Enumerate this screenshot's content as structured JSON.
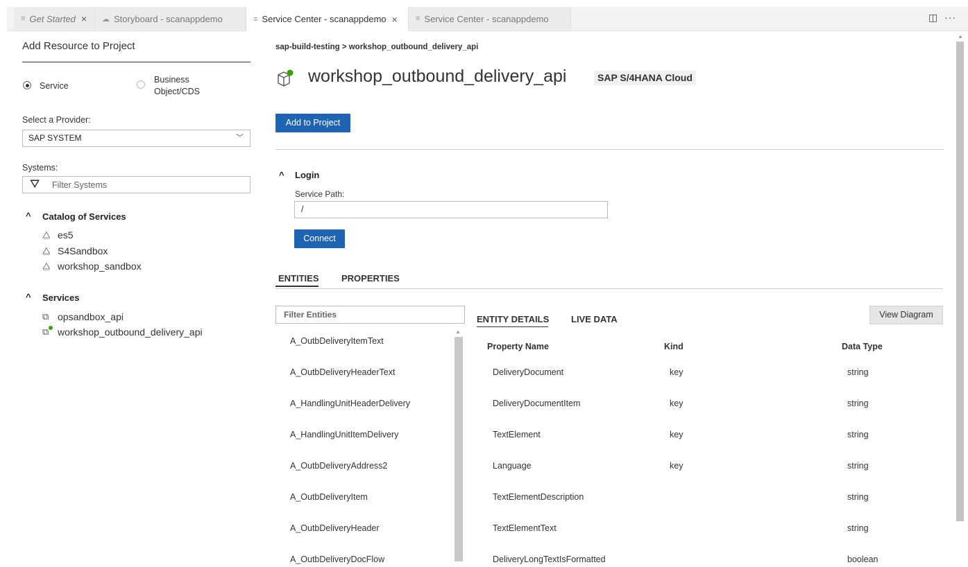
{
  "tabs": [
    {
      "label": "Get Started",
      "italic": true,
      "close": "×"
    },
    {
      "label": "Storyboard - scanappdemo"
    },
    {
      "label": "Service Center - scanappdemo",
      "active": true,
      "close": "×"
    },
    {
      "label": "Service Center - scanappdemo"
    }
  ],
  "window_actions": {
    "split": "◫",
    "more": "···"
  },
  "left": {
    "title": "Add Resource to Project",
    "radio_service": "Service",
    "radio_business_line1": "Business",
    "radio_business_line2": "Object/CDS",
    "provider_label": "Select a Provider:",
    "provider_value": "SAP SYSTEM",
    "systems_label": "Systems:",
    "filter_placeholder": "Filter Systems",
    "catalog_header": "Catalog of Services",
    "catalog_items": [
      "es5",
      "S4Sandbox",
      "workshop_sandbox"
    ],
    "services_header": "Services",
    "service_items": [
      "opsandbox_api",
      "workshop_outbound_delivery_api"
    ]
  },
  "main": {
    "breadcrumb": "sap-build-testing > workshop_outbound_delivery_api",
    "title": "workshop_outbound_delivery_api",
    "badge": "SAP S/4HANA Cloud",
    "add_button": "Add to Project",
    "login_header": "Login",
    "service_path_label": "Service Path:",
    "service_path_value": "/",
    "connect_button": "Connect",
    "tab_entities": "ENTITIES",
    "tab_properties": "PROPERTIES",
    "filter_entities_placeholder": "Filter Entities",
    "entities": [
      "A_OutbDeliveryItemText",
      "A_OutbDeliveryHeaderText",
      "A_HandlingUnitHeaderDelivery",
      "A_HandlingUnitItemDelivery",
      "A_OutbDeliveryAddress2",
      "A_OutbDeliveryItem",
      "A_OutbDeliveryHeader",
      "A_OutbDeliveryDocFlow"
    ],
    "tab_entity_details": "ENTITY DETAILS",
    "tab_live_data": "LIVE DATA",
    "view_diagram": "View Diagram",
    "columns": [
      "Property Name",
      "Kind",
      "Data Type"
    ],
    "rows": [
      [
        "DeliveryDocument",
        "key",
        "string"
      ],
      [
        "DeliveryDocumentItem",
        "key",
        "string"
      ],
      [
        "TextElement",
        "key",
        "string"
      ],
      [
        "Language",
        "key",
        "string"
      ],
      [
        "TextElementDescription",
        "",
        "string"
      ],
      [
        "TextElementText",
        "",
        "string"
      ],
      [
        "DeliveryLongTextIsFormatted",
        "",
        "boolean"
      ]
    ]
  },
  "colors": {
    "accent": "#1f64b3",
    "status_green": "#3aa000"
  }
}
